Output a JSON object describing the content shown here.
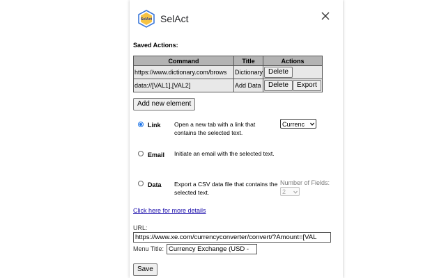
{
  "app": {
    "title": "SelAct",
    "logo_text": "SelAct"
  },
  "saved_actions": {
    "heading": "Saved Actions:",
    "columns": [
      "Command",
      "Title",
      "Actions"
    ],
    "rows": [
      {
        "command": "https://www.dictionary.com/brows",
        "title": "Dictionary",
        "buttons": [
          "Delete"
        ]
      },
      {
        "command": "data://[VAL1],[VAL2]",
        "title": "Add Data",
        "buttons": [
          "Delete",
          "Export"
        ]
      }
    ]
  },
  "add_button": "Add new element",
  "options": {
    "link": {
      "label": "Link",
      "description": "Open a new tab with a link that contains the selected text.",
      "checked": true
    },
    "email": {
      "label": "Email",
      "description": "Initiate an email with the selected text.",
      "checked": false
    },
    "data": {
      "label": "Data",
      "description": "Export a CSV data file that contains the selected text.",
      "checked": false
    }
  },
  "link_select": {
    "value": "Currenc"
  },
  "number_of_fields": {
    "label": "Number of Fields:",
    "value": "2"
  },
  "details_link": "Click here for more details",
  "url": {
    "label": "URL:",
    "value": "https://www.xe.com/currencyconverter/convert/?Amount=[VAL"
  },
  "menu_title": {
    "label": "Menu Title:",
    "value": "Currency Exchange (USD -"
  },
  "save_button": "Save",
  "colors": {
    "accent": "#1a73e8",
    "link": "#1a0dab",
    "table_header": "#b3b3b3",
    "table_cell": "#e8e8e8"
  }
}
